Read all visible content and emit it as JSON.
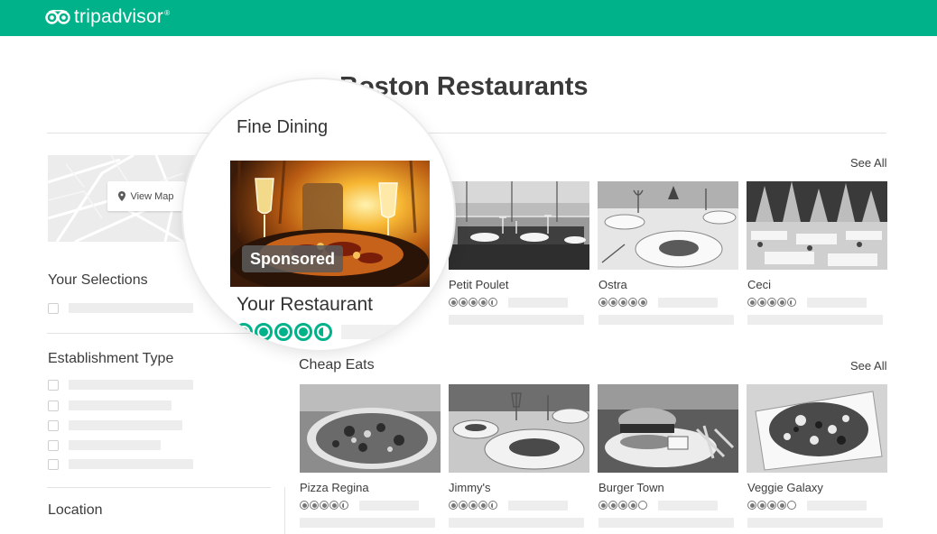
{
  "brand": {
    "name": "tripadvisor",
    "trademark": "®",
    "color": "#00b28a"
  },
  "page_title": "Boston Restaurants",
  "map": {
    "button_label": "View Map",
    "icon": "map-pin-icon"
  },
  "sidebar": {
    "your_selections": "Your Selections",
    "establishment_type": "Establishment Type",
    "location": "Location"
  },
  "fine_dining": {
    "title": "Fine Dining",
    "see_all": "See All",
    "featured": {
      "name": "Your Restaurant",
      "badge": "Sponsored",
      "rating": 4.5
    },
    "cards": [
      {
        "name": "Petit Poulet",
        "rating": 4.5
      },
      {
        "name": "Ostra",
        "rating": 5
      },
      {
        "name": "Ceci",
        "rating": 4.5
      }
    ]
  },
  "cheap_eats": {
    "title": "Cheap Eats",
    "see_all": "See All",
    "cards": [
      {
        "name": "Pizza Regina",
        "rating": 4.5
      },
      {
        "name": "Jimmy's",
        "rating": 4.5
      },
      {
        "name": "Burger Town",
        "rating": 4
      },
      {
        "name": "Veggie Galaxy",
        "rating": 4
      }
    ]
  }
}
